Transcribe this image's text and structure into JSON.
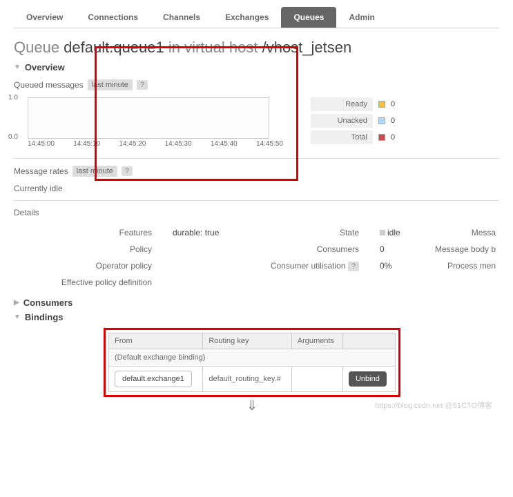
{
  "tabs": [
    "Overview",
    "Connections",
    "Channels",
    "Exchanges",
    "Queues",
    "Admin"
  ],
  "active_tab": "Queues",
  "title": {
    "prefix": "Queue ",
    "name": "default.queue1",
    "mid": " in virtual host ",
    "vhost": "/vhost_jetsen"
  },
  "sections": {
    "overview": "Overview",
    "consumers": "Consumers",
    "bindings": "Bindings"
  },
  "queued_messages": {
    "label": "Queued messages",
    "badge": "last minute",
    "y_max": "1.0",
    "y_min": "0.0",
    "x_ticks": [
      "14:45:00",
      "14:45:10",
      "14:45:20",
      "14:45:30",
      "14:45:40",
      "14:45:50"
    ]
  },
  "legend": [
    {
      "label": "Ready",
      "value": "0",
      "color": "#edc240"
    },
    {
      "label": "Unacked",
      "value": "0",
      "color": "#afd8f8"
    },
    {
      "label": "Total",
      "value": "0",
      "color": "#cb4b4b"
    }
  ],
  "message_rates": {
    "label": "Message rates",
    "badge": "last minute",
    "status": "Currently idle"
  },
  "details": {
    "heading": "Details",
    "left_labels": [
      "Features",
      "Policy",
      "Operator policy",
      "Effective policy definition"
    ],
    "features_val": "durable: true",
    "mid_labels": [
      "State",
      "Consumers",
      "Consumer utilisation"
    ],
    "state_val": "idle",
    "consumers_val": "0",
    "utilisation_val": "0%",
    "right_labels": [
      "Messa",
      "Message body b",
      "Process men"
    ]
  },
  "bindings": {
    "headers": [
      "From",
      "Routing key",
      "Arguments"
    ],
    "default_row": "(Default exchange binding)",
    "exchange": "default.exchange1",
    "routing_key": "default_routing_key.#",
    "unbind_label": "Unbind"
  },
  "help": "?",
  "watermark": "https://blog.csdn.net @51CTO博客"
}
